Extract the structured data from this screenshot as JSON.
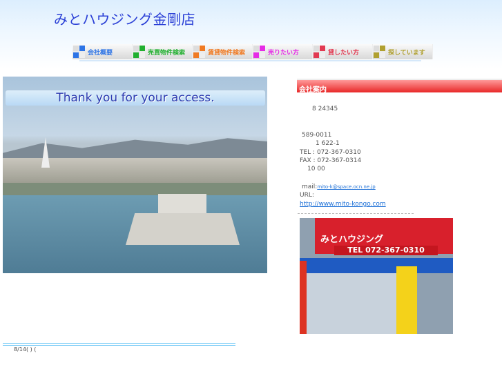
{
  "header": {
    "title": "みとハウジング金剛店"
  },
  "nav": [
    {
      "label": "会社概要",
      "color": "#2d74e6"
    },
    {
      "label": "売買物件検索",
      "color": "#22b030"
    },
    {
      "label": "賃貸物件検索",
      "color": "#f07a22"
    },
    {
      "label": "売りたい方",
      "color": "#e62ce6"
    },
    {
      "label": "貸したい方",
      "color": "#e23a52"
    },
    {
      "label": "探しています",
      "color": "#b0a030"
    }
  ],
  "photo": {
    "banner": "Thank you for your access."
  },
  "company": {
    "heading": "会社案内",
    "license": "8  24345",
    "postal": "589-0011",
    "address": "1  622-1",
    "tel": "TEL : 072-367-0310",
    "fax": "FAX : 072-367-0314",
    "hours": "10 00",
    "mail_label": "mail:",
    "mail": "mito-k@space.ocn.ne.jp",
    "url_label": "URL:",
    "url": "http://www.mito-kongo.com"
  },
  "store": {
    "sign": "みとハウジング",
    "tel": "TEL 072-367-0310"
  },
  "footer": {
    "date": "8/14( )     ("
  }
}
